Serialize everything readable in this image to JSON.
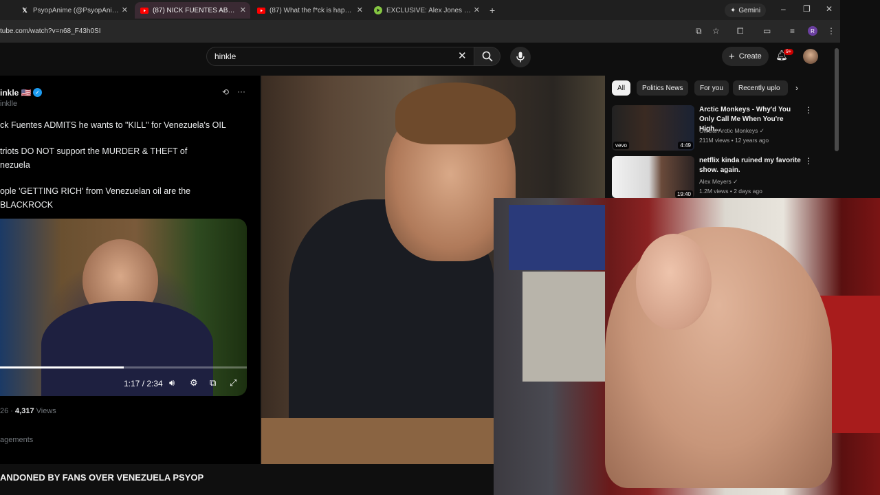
{
  "tabs": [
    {
      "label": "PsyopAnime (@PsyopAnime) /",
      "icon": "x-logo-icon",
      "active": false
    },
    {
      "label": "(87) NICK FUENTES ABANDONED",
      "icon": "youtube-icon",
      "active": true
    },
    {
      "label": "(87) What the f*ck is happening",
      "icon": "youtube-icon",
      "active": false
    },
    {
      "label": "EXCLUSIVE: Alex Jones Debates",
      "icon": "rumble-icon",
      "active": false
    }
  ],
  "browser": {
    "url": "tube.com/watch?v=n68_F43h0SI",
    "gemini_label": "Gemini",
    "profile_initial": "R"
  },
  "youtube": {
    "search_value": "hinkle",
    "create_label": "Create",
    "notification_count": "9+"
  },
  "tweet": {
    "name": "inkle",
    "flag": "🇺🇸",
    "handle": "inklle",
    "line1": "ck Fuentes ADMITS he wants to \"KILL\" for Venezuela's OIL",
    "line2a": "triots DO NOT support the MURDER & THEFT of",
    "line2b": "nezuela",
    "line3a": "ople 'GETTING RICH' from Venezuelan oil are the",
    "line3b": "BLACKROCK",
    "video_time": "1:17 / 2:34",
    "progress": 0.5,
    "stats_date": "26",
    "stats_views": "4,317",
    "stats_views_label": "Views",
    "engagements": "agements"
  },
  "chips": [
    "All",
    "Politics News",
    "For you",
    "Recently uplo"
  ],
  "recommendations": [
    {
      "title": "Arctic Monkeys - Why'd You Only Call Me When You're High...",
      "channel": "Official Arctic Monkeys",
      "meta": "211M views • 12 years ago",
      "duration": "4:49",
      "badge": "vevo"
    },
    {
      "title": "netflix kinda ruined my favorite show. again.",
      "channel": "Alex Meyers",
      "meta": "1.2M views • 2 days ago",
      "duration": "19:40",
      "badge": ""
    }
  ],
  "main_video": {
    "title": "ANDONED BY FANS OVER VENEZUELA PSYOP"
  },
  "colors": {
    "yt_red": "#ff0000",
    "x_blue": "#1d9bf0",
    "tab_active": "#3a2a33"
  }
}
